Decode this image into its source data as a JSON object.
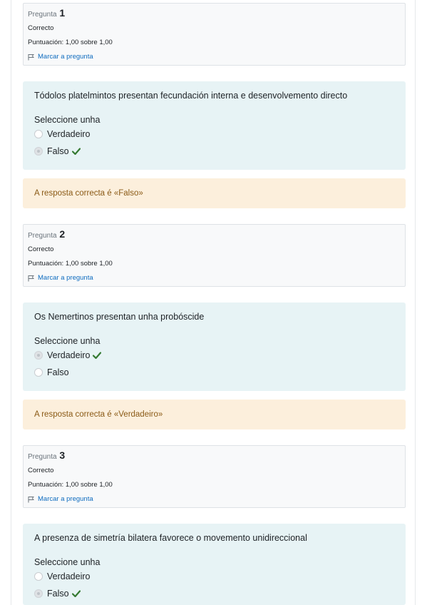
{
  "questions": [
    {
      "label": "Pregunta",
      "number": "1",
      "state": "Correcto",
      "grade": "Puntuación: 1,00 sobre 1,00",
      "flag_label": "Marcar a pregunta",
      "text": "Tódolos platelmintos presentan fecundación interna e desenvolvemento directo",
      "prompt": "Seleccione unha",
      "options": [
        {
          "label": "Verdadeiro",
          "selected": false,
          "correct_mark": false
        },
        {
          "label": "Falso",
          "selected": true,
          "correct_mark": true
        }
      ],
      "feedback": "A resposta correcta é «Falso»"
    },
    {
      "label": "Pregunta",
      "number": "2",
      "state": "Correcto",
      "grade": "Puntuación: 1,00 sobre 1,00",
      "flag_label": "Marcar a pregunta",
      "text": "Os Nemertinos presentan unha probóscide",
      "prompt": "Seleccione unha",
      "options": [
        {
          "label": "Verdadeiro",
          "selected": true,
          "correct_mark": true
        },
        {
          "label": "Falso",
          "selected": false,
          "correct_mark": false
        }
      ],
      "feedback": "A resposta correcta é «Verdadeiro»"
    },
    {
      "label": "Pregunta",
      "number": "3",
      "state": "Correcto",
      "grade": "Puntuación: 1,00 sobre 1,00",
      "flag_label": "Marcar a pregunta",
      "text": "A presenza de simetría bilatera  favorece o movemento unidireccional",
      "prompt": "Seleccione unha",
      "options": [
        {
          "label": "Verdadeiro",
          "selected": false,
          "correct_mark": false
        },
        {
          "label": "Falso",
          "selected": true,
          "correct_mark": true
        }
      ],
      "feedback": ""
    }
  ],
  "colors": {
    "info_bg": "#f8f9fa",
    "formulation_bg": "#e7f3f5",
    "feedback_bg": "#fcefdc",
    "check": "#357a32",
    "link": "#0f6cbf"
  },
  "icons": {
    "flag": "flag-icon",
    "correct": "check-icon"
  }
}
